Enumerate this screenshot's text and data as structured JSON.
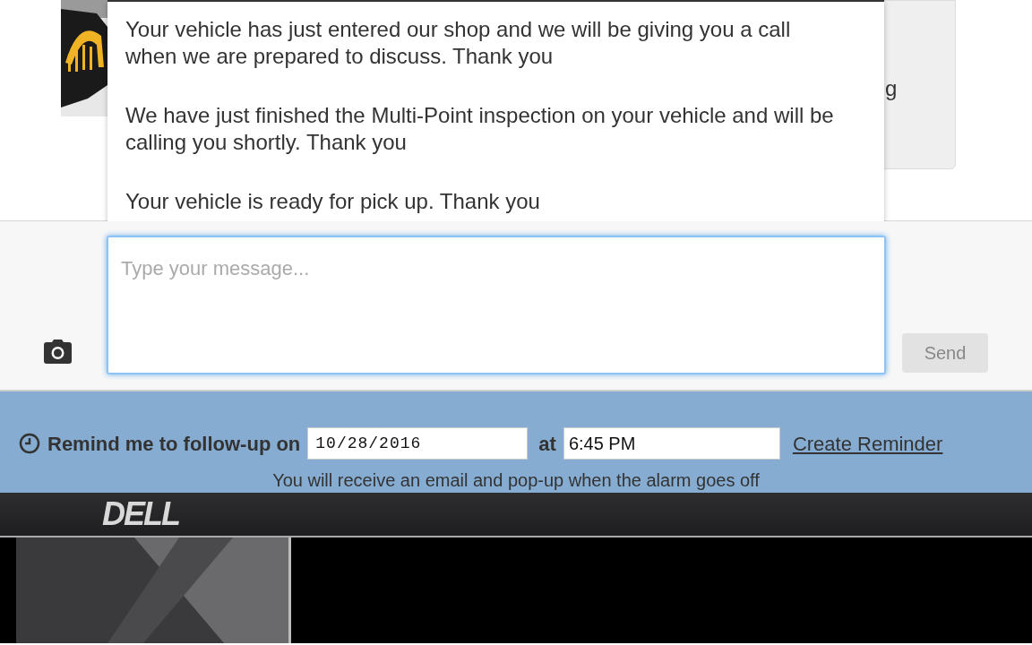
{
  "conversation": {
    "hidden_bubble_text": "g"
  },
  "quick_replies": [
    {
      "text": "Your vehicle has just entered our shop and we will be giving you a call when we are prepared to discuss. Thank you"
    },
    {
      "text": "We have just finished the Multi-Point inspection on your vehicle and will be calling you shortly. Thank you"
    },
    {
      "text": "Your vehicle is ready for pick up. Thank you"
    }
  ],
  "composer": {
    "placeholder": "Type your message...",
    "focused": true,
    "send_button": {
      "label": "Send",
      "disabled": true
    }
  },
  "reminder": {
    "label": "Remind me to follow-up on",
    "date": "10/28/2016",
    "at_label": "at",
    "time": "6:45 PM",
    "link": "Create Reminder",
    "note": "You will receive an email and pop-up when the alarm goes off"
  },
  "monitor_bezel": {
    "logo": "DELL"
  }
}
